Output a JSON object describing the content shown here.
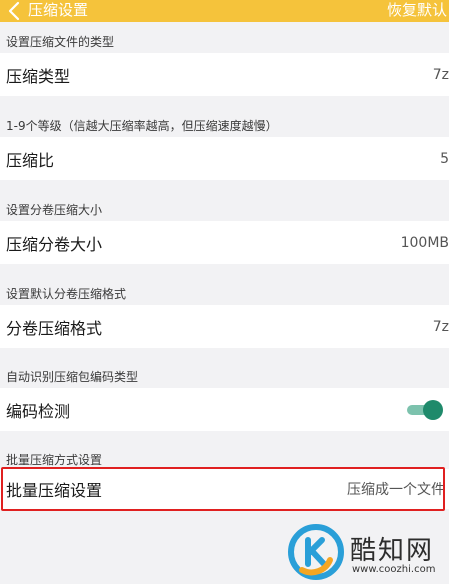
{
  "header": {
    "title": "压缩设置",
    "reset_label": "恢复默认",
    "background": "#f5c33b"
  },
  "sections": [
    {
      "description": "设置压缩文件的类型",
      "label": "压缩类型",
      "value": "7z"
    },
    {
      "description": "1-9个等级（信越大压缩率越高，但压缩速度越慢）",
      "label": "压缩比",
      "value": "5"
    },
    {
      "description": "设置分卷压缩大小",
      "label": "压缩分卷大小",
      "value": "100MB"
    },
    {
      "description": "设置默认分卷压缩格式",
      "label": "分卷压缩格式",
      "value": "7z"
    },
    {
      "description": "自动识别压缩包编码类型",
      "label": "编码检测",
      "toggle_on": true,
      "toggle_color": "#1f8a6b"
    },
    {
      "description": "批量压缩方式设置",
      "label": "批量压缩设置",
      "value": "压缩成一个文件"
    }
  ],
  "highlight_color": "#e02020",
  "icons": {
    "back": "chevron-left-icon",
    "toggle": "toggle-switch-icon",
    "watermark_logo": "coozhi-logo-icon"
  },
  "watermark": {
    "name": "酷知网",
    "url": "www.coozhi.com"
  }
}
